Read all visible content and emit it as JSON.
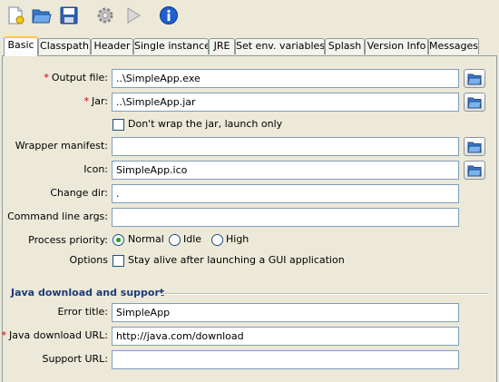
{
  "toolbar": {
    "icons": [
      "new-config-icon",
      "open-folder-icon",
      "save-disk-icon",
      "build-gear-icon",
      "run-play-icon",
      "info-icon"
    ]
  },
  "tabs": [
    {
      "label": "Basic",
      "active": true
    },
    {
      "label": "Classpath"
    },
    {
      "label": "Header"
    },
    {
      "label": "Single instance"
    },
    {
      "label": "JRE"
    },
    {
      "label": "Set env. variables"
    },
    {
      "label": "Splash"
    },
    {
      "label": "Version Info"
    },
    {
      "label": "Messages"
    }
  ],
  "basic": {
    "output_file": {
      "label": "Output file:",
      "value": "..\\SimpleApp.exe",
      "required": true
    },
    "jar": {
      "label": "Jar:",
      "value": "..\\SimpleApp.jar",
      "required": true
    },
    "dont_wrap": {
      "label": "Don't wrap the jar, launch only",
      "checked": false
    },
    "wrapper_manifest": {
      "label": "Wrapper manifest:",
      "value": ""
    },
    "icon": {
      "label": "Icon:",
      "value": "SimpleApp.ico"
    },
    "change_dir": {
      "label": "Change dir:",
      "value": "."
    },
    "command_line_args": {
      "label": "Command line args:",
      "value": ""
    },
    "process_priority": {
      "label": "Process priority:",
      "options": [
        "Normal",
        "Idle",
        "High"
      ],
      "selected": "Normal"
    },
    "options": {
      "label": "Options",
      "stay_alive": "Stay alive after launching a GUI application",
      "checked": false
    }
  },
  "java_download": {
    "section_title": "Java download and support",
    "error_title": {
      "label": "Error title:",
      "value": "SimpleApp"
    },
    "java_download_url": {
      "label": "Java download URL:",
      "value": "http://java.com/download",
      "required": true
    },
    "support_url": {
      "label": "Support URL:",
      "value": ""
    }
  },
  "colors": {
    "accent_tab": "#ffc83c",
    "required_star": "#c00000",
    "section_title": "#1c3d7a",
    "radio_dot": "#21a121"
  }
}
